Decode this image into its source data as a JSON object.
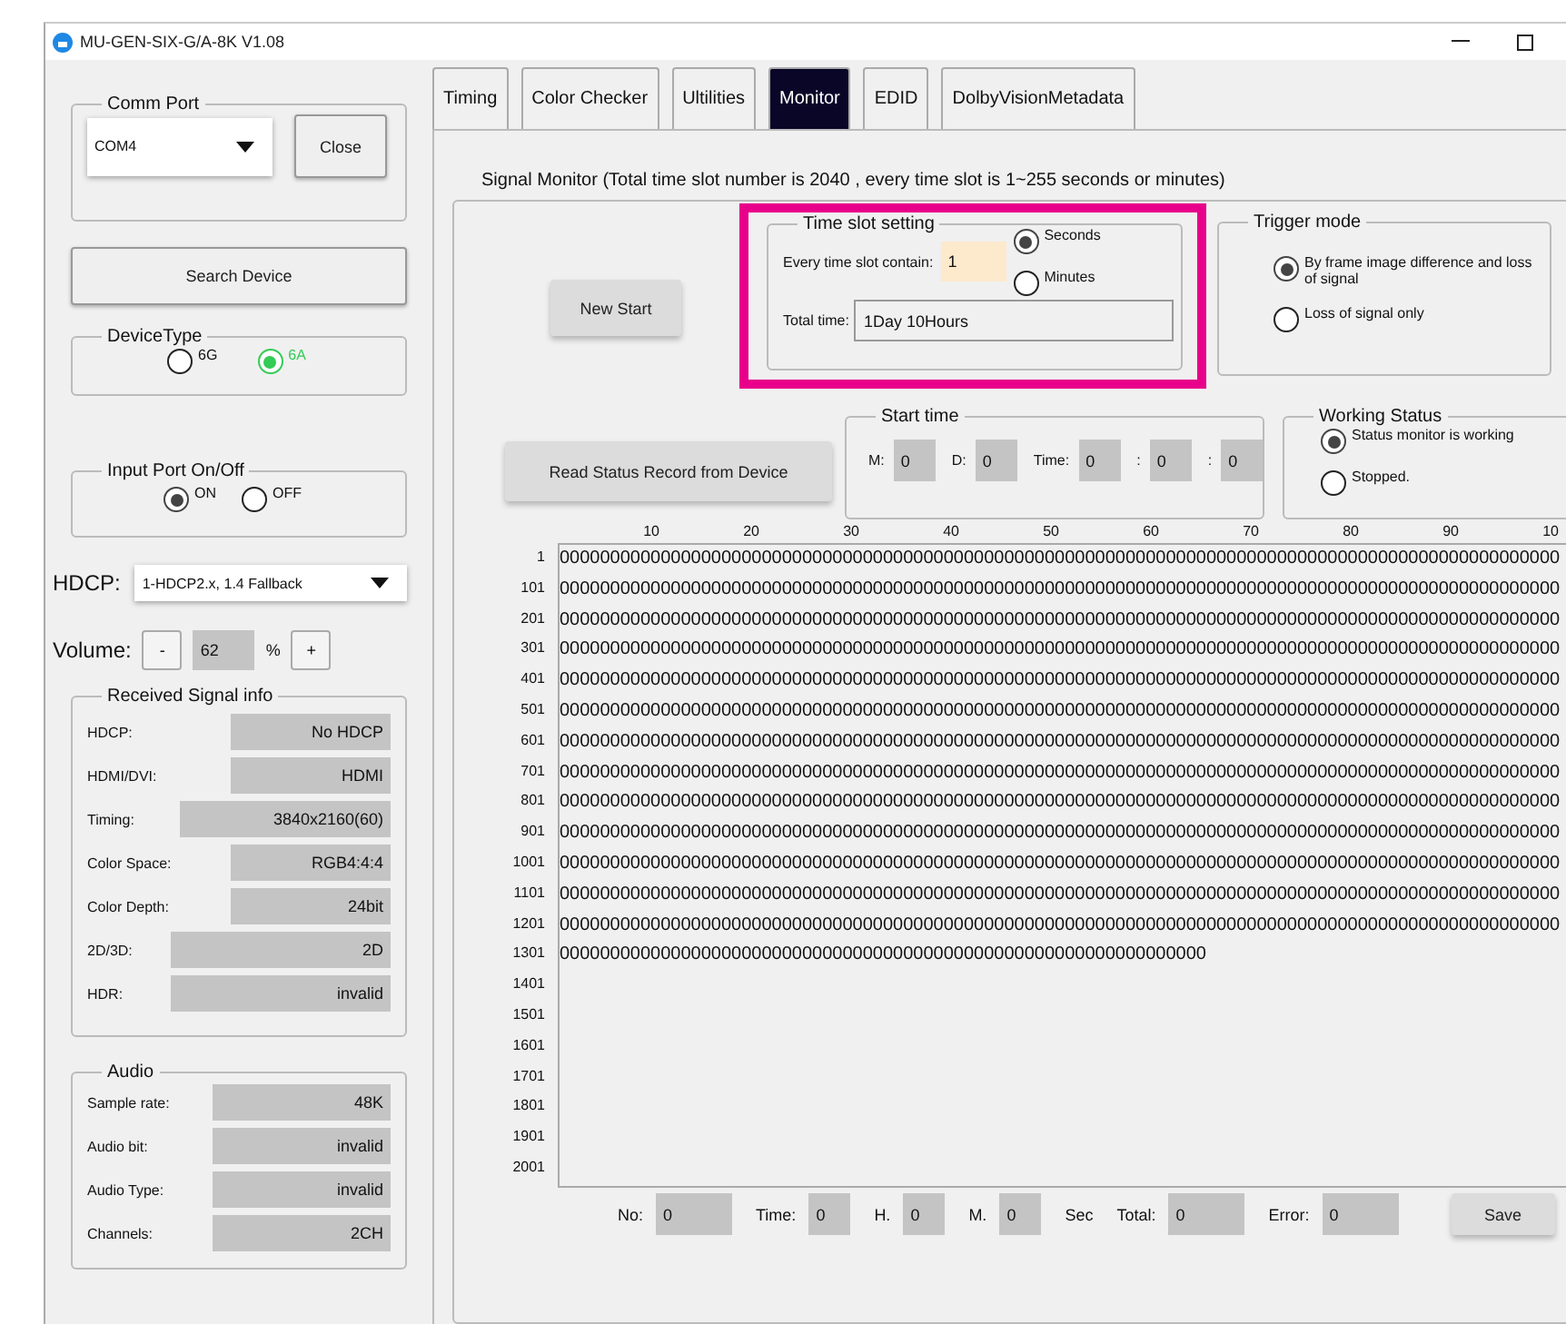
{
  "window": {
    "title": "MU-GEN-SIX-G/A-8K V1.08"
  },
  "comm_port": {
    "title": "Comm Port",
    "port": "COM4",
    "button": "Close"
  },
  "search_button": "Search Device",
  "device_type": {
    "title": "DeviceType",
    "options": [
      {
        "label": "6G",
        "selected": false
      },
      {
        "label": "6A",
        "selected": true
      }
    ]
  },
  "input_port": {
    "title": "Input Port On/Off",
    "options": [
      {
        "label": "ON",
        "selected": true
      },
      {
        "label": "OFF",
        "selected": false
      }
    ]
  },
  "hdcp": {
    "label": "HDCP:",
    "value": "1-HDCP2.x, 1.4 Fallback"
  },
  "volume": {
    "label": "Volume:",
    "minus": "-",
    "value": "62",
    "unit": "%",
    "plus": "+"
  },
  "received_signal": {
    "title": "Received Signal info",
    "rows": [
      {
        "label": "HDCP:",
        "value": "No HDCP",
        "kind": "short"
      },
      {
        "label": "HDMI/DVI:",
        "value": "HDMI",
        "kind": "short"
      },
      {
        "label": "Timing:",
        "value": "3840x2160(60)",
        "kind": "long"
      },
      {
        "label": "Color Space:",
        "value": "RGB4:4:4",
        "kind": "short"
      },
      {
        "label": "Color Depth:",
        "value": "24bit",
        "kind": "short"
      },
      {
        "label": "2D/3D:",
        "value": "2D",
        "kind": "wide"
      },
      {
        "label": "HDR:",
        "value": "invalid",
        "kind": "wide"
      }
    ]
  },
  "audio": {
    "title": "Audio",
    "rows": [
      {
        "label": "Sample rate:",
        "value": "48K"
      },
      {
        "label": "Audio bit:",
        "value": "invalid"
      },
      {
        "label": "Audio Type:",
        "value": "invalid"
      },
      {
        "label": "Channels:",
        "value": "2CH"
      }
    ]
  },
  "tabs": [
    {
      "label": "Timing",
      "selected": false
    },
    {
      "label": "Color Checker",
      "selected": false
    },
    {
      "label": "Ultilities",
      "selected": false
    },
    {
      "label": "Monitor",
      "selected": true
    },
    {
      "label": "EDID",
      "selected": false
    },
    {
      "label": "DolbyVisionMetadata",
      "selected": false
    }
  ],
  "monitor": {
    "heading": "Signal Monitor (Total time slot number is 2040 , every time slot is 1~255 seconds or minutes)",
    "new_start": "New Start",
    "time_slot": {
      "title": "Time slot setting",
      "contain_label": "Every time slot contain:",
      "contain_value": "1",
      "units": [
        {
          "label": "Seconds",
          "selected": true
        },
        {
          "label": "Minutes",
          "selected": false
        }
      ],
      "total_label": "Total time:",
      "total_value": "1Day 10Hours"
    },
    "trigger": {
      "title": "Trigger mode",
      "options": [
        {
          "label": "By frame image difference and loss of signal",
          "selected": true
        },
        {
          "label": "Loss of signal only",
          "selected": false
        }
      ]
    },
    "read_button": "Read Status Record from Device",
    "start_time": {
      "title": "Start time",
      "fields": [
        {
          "label": "M:",
          "value": "0",
          "kind": "wide"
        },
        {
          "label": "D:",
          "value": "0",
          "kind": "wide"
        },
        {
          "label": "Time:",
          "value": "0",
          "kind": "wide"
        },
        {
          "label": ":",
          "value": "0",
          "kind": "wide"
        },
        {
          "label": ":",
          "value": "0",
          "kind": "narrow"
        }
      ]
    },
    "working_status": {
      "title": "Working Status",
      "options": [
        {
          "label": "Status monitor is working",
          "selected": true
        },
        {
          "label": "Stopped.",
          "selected": false
        }
      ]
    },
    "grid": {
      "columns": [
        "10",
        "20",
        "30",
        "40",
        "50",
        "60",
        "70",
        "80",
        "90",
        "10"
      ],
      "rows": [
        {
          "label": "1",
          "data": "000000000000000000000000000000000000000000000000000000000000000000000000000000000000000000000000000"
        },
        {
          "label": "101",
          "data": "000000000000000000000000000000000000000000000000000000000000000000000000000000000000000000000000000"
        },
        {
          "label": "201",
          "data": "000000000000000000000000000000000000000000000000000000000000000000000000000000000000000000000000000"
        },
        {
          "label": "301",
          "data": "000000000000000000000000000000000000000000000000000000000000000000000000000000000000000000000000000"
        },
        {
          "label": "401",
          "data": "000000000000000000000000000000000000000000000000000000000000000000000000000000000000000000000000000"
        },
        {
          "label": "501",
          "data": "000000000000000000000000000000000000000000000000000000000000000000000000000000000000000000000000000"
        },
        {
          "label": "601",
          "data": "000000000000000000000000000000000000000000000000000000000000000000000000000000000000000000000000000"
        },
        {
          "label": "701",
          "data": "000000000000000000000000000000000000000000000000000000000000000000000000000000000000000000000000000"
        },
        {
          "label": "801",
          "data": "000000000000000000000000000000000000000000000000000000000000000000000000000000000000000000000000000"
        },
        {
          "label": "901",
          "data": "000000000000000000000000000000000000000000000000000000000000000000000000000000000000000000000000000"
        },
        {
          "label": "1001",
          "data": "000000000000000000000000000000000000000000000000000000000000000000000000000000000000000000000000000"
        },
        {
          "label": "1101",
          "data": "000000000000000000000000000000000000000000000000000000000000000000000000000000000000000000000000000"
        },
        {
          "label": "1201",
          "data": "000000000000000000000000000000000000000000000000000000000000000000000000000000000000000000000000000"
        },
        {
          "label": "1301",
          "data": "0000000000000000000000000000000000000000000000000000000000000000"
        },
        {
          "label": "1401"
        },
        {
          "label": "1501"
        },
        {
          "label": "1601"
        },
        {
          "label": "1701"
        },
        {
          "label": "1801"
        },
        {
          "label": "1901"
        },
        {
          "label": "2001"
        }
      ]
    },
    "footer": [
      {
        "kind": "label",
        "text": "No:"
      },
      {
        "kind": "field",
        "text": "0"
      },
      {
        "kind": "label",
        "text": "Time:"
      },
      {
        "kind": "short_field",
        "text": "0"
      },
      {
        "kind": "label",
        "text": "H."
      },
      {
        "kind": "short_field",
        "text": "0"
      },
      {
        "kind": "label",
        "text": "M."
      },
      {
        "kind": "short_field",
        "text": "0"
      },
      {
        "kind": "label",
        "text": "Sec"
      },
      {
        "kind": "label",
        "text": "Total:"
      },
      {
        "kind": "field",
        "text": "0"
      },
      {
        "kind": "label",
        "text": "Error:"
      },
      {
        "kind": "field",
        "text": "0"
      }
    ],
    "save_button": "Save"
  }
}
